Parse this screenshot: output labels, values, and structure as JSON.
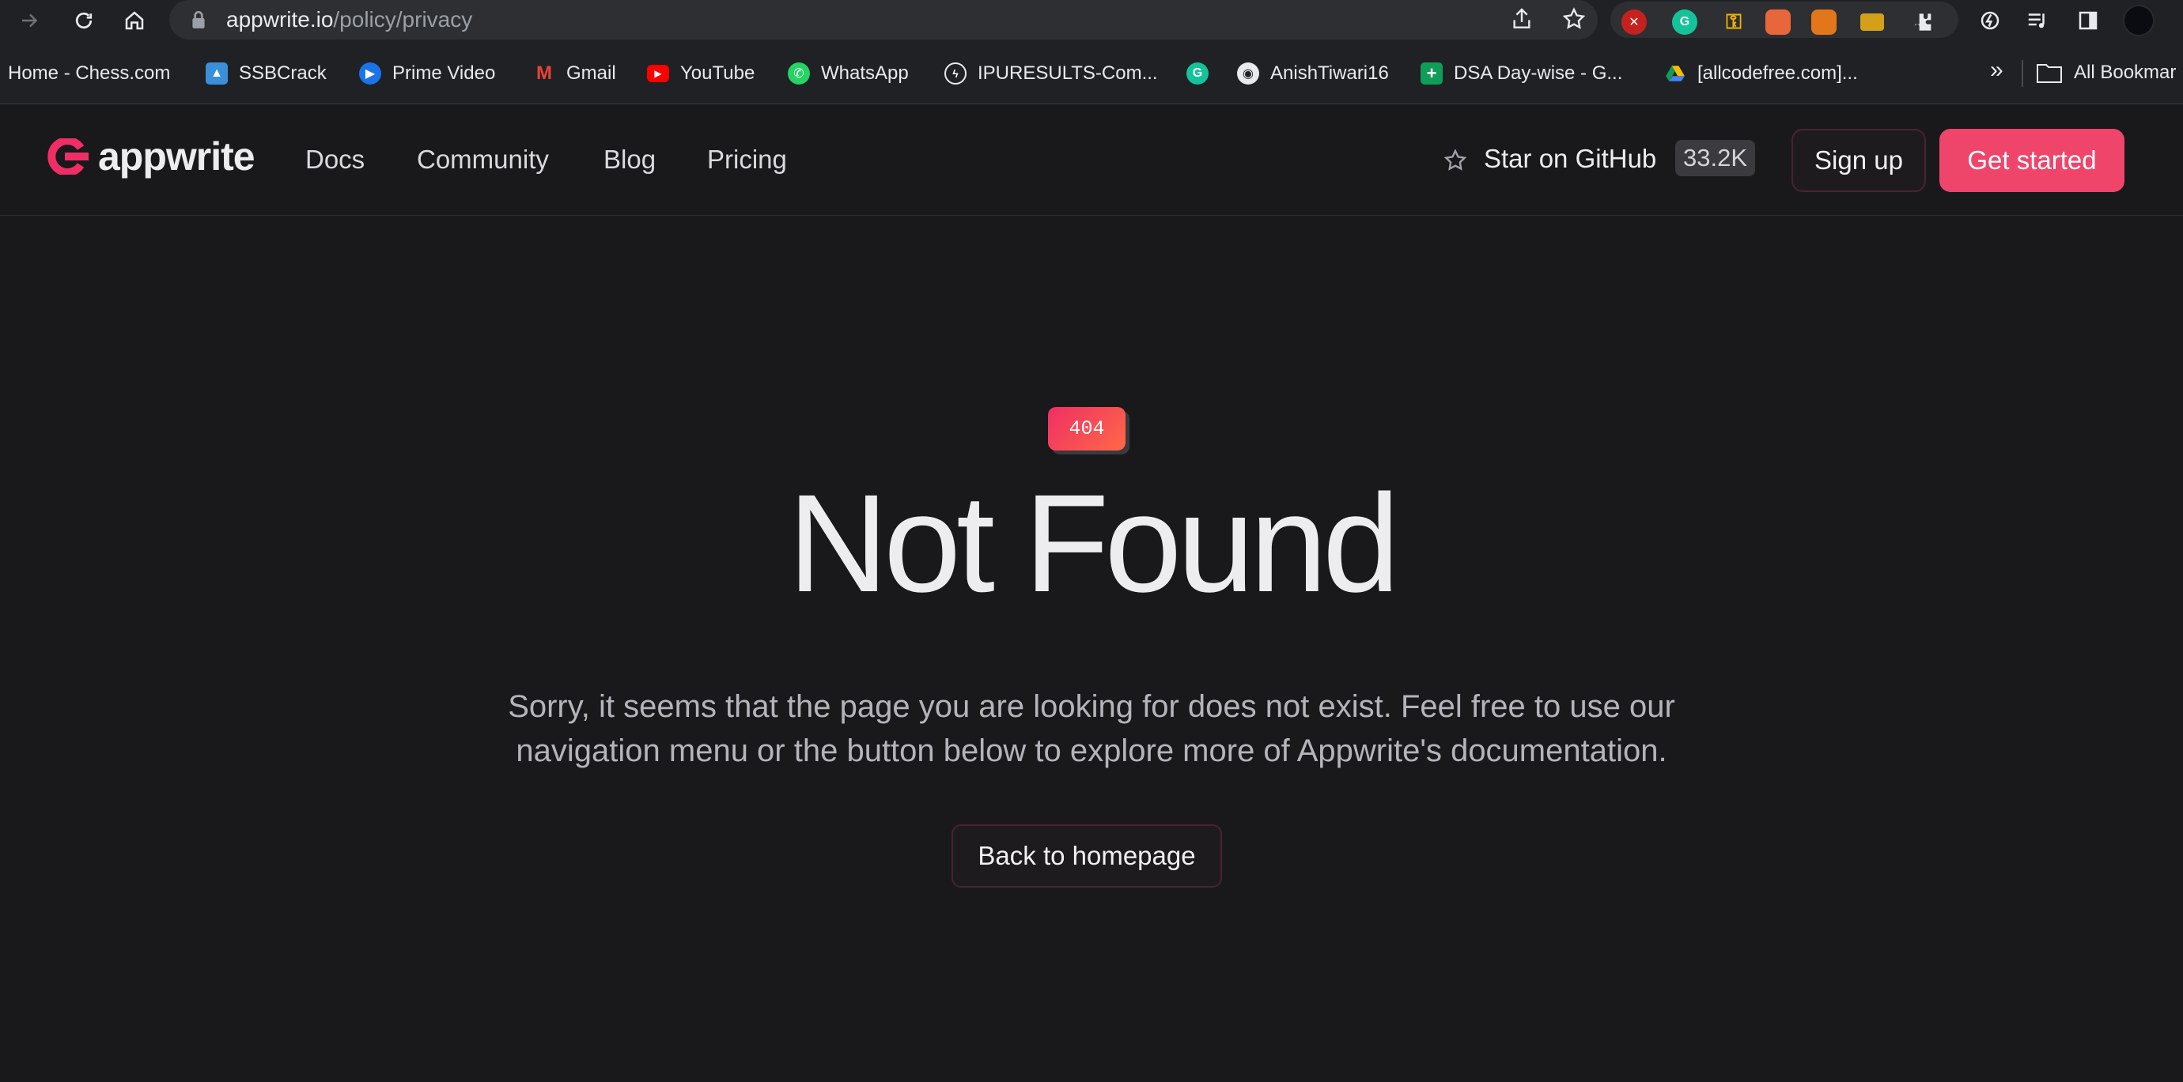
{
  "browser": {
    "url_host": "appwrite.io",
    "url_path": "/policy/privacy",
    "bookmarks": [
      {
        "label": "Home - Chess.com",
        "icon": "chess-icon",
        "color": "#202124"
      },
      {
        "label": "SSBCrack",
        "icon": "ssbcrack-icon",
        "color": "#3b8fd9"
      },
      {
        "label": "Prime Video",
        "icon": "prime-video-icon",
        "color": "#1a73e8"
      },
      {
        "label": "Gmail",
        "icon": "gmail-icon",
        "color": "#ea4335"
      },
      {
        "label": "YouTube",
        "icon": "youtube-icon",
        "color": "#ff0000"
      },
      {
        "label": "WhatsApp",
        "icon": "whatsapp-icon",
        "color": "#25d366"
      },
      {
        "label": "IPURESULTS-Com...",
        "icon": "ipuresults-icon",
        "color": "#202124"
      },
      {
        "label": "",
        "icon": "grammarly-icon",
        "color": "#15c39a"
      },
      {
        "label": "AnishTiwari16",
        "icon": "github-icon",
        "color": "#202124"
      },
      {
        "label": "DSA Day-wise - G...",
        "icon": "sheets-icon",
        "color": "#0f9d58"
      },
      {
        "label": "[allcodefree.com]...",
        "icon": "drive-icon",
        "color": "#fbbc04"
      }
    ],
    "more_bookmarks": "»",
    "all_bookmarks": "All Bookmar"
  },
  "site": {
    "logo_text": "appwrite",
    "nav": [
      "Docs",
      "Community",
      "Blog",
      "Pricing"
    ],
    "github_label": "Star on GitHub",
    "github_count": "33.2K",
    "signup_label": "Sign up",
    "get_started_label": "Get started"
  },
  "main": {
    "badge": "404",
    "title": "Not Found",
    "description_line1": "Sorry, it seems that the page you are looking for does not exist. Feel free to use our",
    "description_line2": "navigation menu or the button below to explore more of Appwrite's documentation.",
    "home_button": "Back to homepage"
  },
  "colors": {
    "background": "#19191c",
    "accent": "#f02e65",
    "accent_gradient_end": "#fe6947"
  }
}
